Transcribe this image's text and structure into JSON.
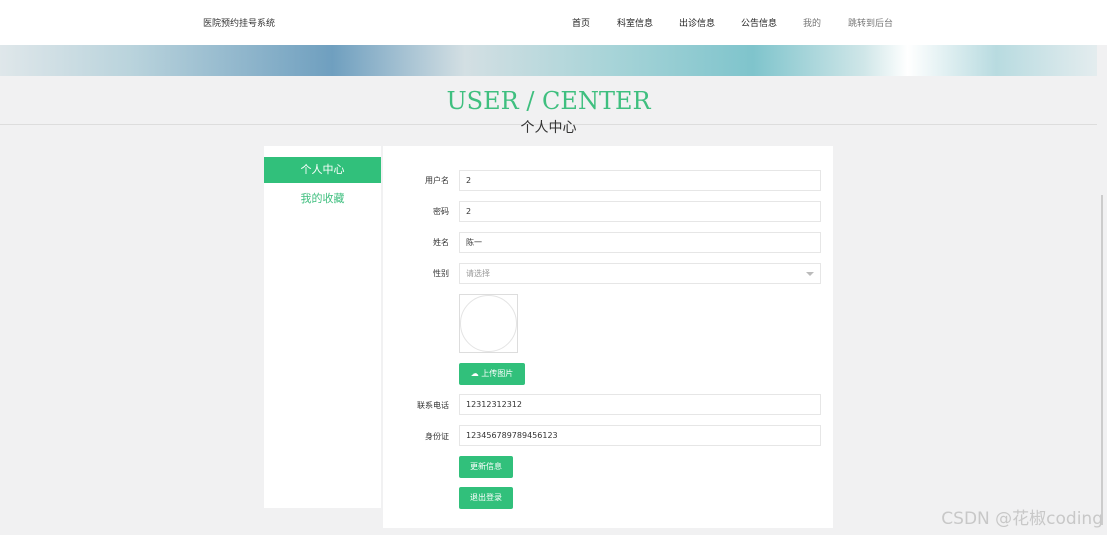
{
  "header": {
    "brand": "医院预约挂号系统",
    "nav": [
      {
        "label": "首页"
      },
      {
        "label": "科室信息"
      },
      {
        "label": "出诊信息"
      },
      {
        "label": "公告信息"
      },
      {
        "label": "我的"
      },
      {
        "label": "跳转到后台"
      }
    ]
  },
  "page": {
    "title_en": "USER / CENTER",
    "title_cn": "个人中心"
  },
  "sidebar": {
    "items": [
      {
        "label": "个人中心",
        "active": true
      },
      {
        "label": "我的收藏"
      }
    ]
  },
  "form": {
    "username": {
      "label": "用户名",
      "value": "2"
    },
    "password": {
      "label": "密码",
      "value": "2"
    },
    "name": {
      "label": "姓名",
      "value": "陈一"
    },
    "gender": {
      "label": "性别",
      "placeholder": "请选择"
    },
    "upload_label": "上传图片",
    "phone": {
      "label": "联系电话",
      "value": "12312312312"
    },
    "idcard": {
      "label": "身份证",
      "value": "123456789789456123"
    },
    "update_label": "更新信息",
    "logout_label": "退出登录"
  },
  "colors": {
    "accent": "#31c07b"
  },
  "watermark": "CSDN @花椒coding"
}
